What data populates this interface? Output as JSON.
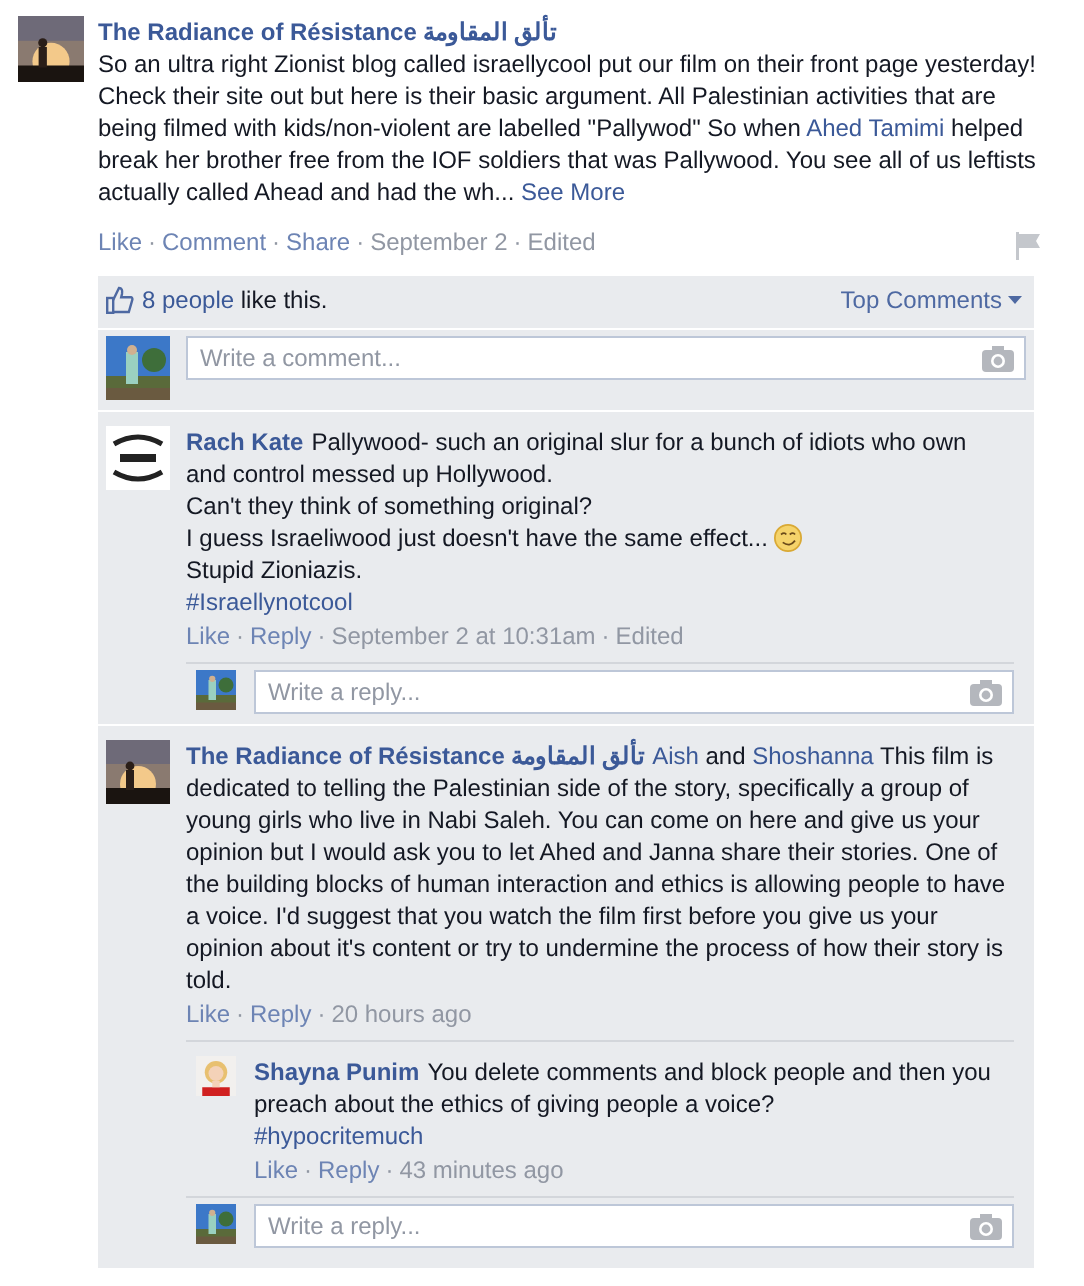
{
  "post": {
    "author": "The Radiance of Résistance تألق المقاومة",
    "body": [
      {
        "kind": "text",
        "text": "So an ultra right Zionist blog called israellycool put our film on their front page yesterday! Check their site out but here is their basic argument. All Palestinian activities that are being filmed with kids/non-violent are labelled \"Pallywod\" So when "
      },
      {
        "kind": "link",
        "text": "Ahed Tamimi"
      },
      {
        "kind": "text",
        "text": " helped break her brother free from the IOF soldiers that was Pallywood. You see all of us leftists actually called Ahead and had the wh... "
      },
      {
        "kind": "link",
        "text": "See More"
      }
    ],
    "actions": [
      {
        "kind": "link",
        "text": "Like"
      },
      {
        "kind": "sep",
        "text": "·"
      },
      {
        "kind": "link",
        "text": "Comment"
      },
      {
        "kind": "sep",
        "text": "·"
      },
      {
        "kind": "link",
        "text": "Share"
      },
      {
        "kind": "sep",
        "text": "·"
      },
      {
        "kind": "meta",
        "text": "September 2"
      },
      {
        "kind": "sep",
        "text": "·"
      },
      {
        "kind": "meta",
        "text": "Edited"
      }
    ]
  },
  "likes": {
    "count_link": "8 people",
    "text": " like this.",
    "sort": "Top Comments"
  },
  "comment_box": {
    "placeholder": "Write a comment..."
  },
  "comments": [
    {
      "author": "Rach Kate",
      "body": [
        {
          "kind": "text",
          "text": "Pallywood- such an original slur for a bunch of idiots who own and control messed up Hollywood.\nCan't they think of something original?\nI guess Israeliwood just doesn't have the same effect... "
        },
        {
          "kind": "emoji"
        },
        {
          "kind": "text",
          "text": "\nStupid Zioniazis.\n"
        },
        {
          "kind": "link",
          "text": "#Israellynotcool"
        }
      ],
      "actions": [
        {
          "kind": "link",
          "text": "Like"
        },
        {
          "kind": "sep",
          "text": "·"
        },
        {
          "kind": "link",
          "text": "Reply"
        },
        {
          "kind": "sep",
          "text": "·"
        },
        {
          "kind": "meta",
          "text": "September 2 at 10:31am"
        },
        {
          "kind": "sep",
          "text": "·"
        },
        {
          "kind": "meta",
          "text": "Edited"
        }
      ],
      "reply_box": {
        "placeholder": "Write a reply..."
      }
    },
    {
      "author": "The Radiance of Résistance تألق المقاومة",
      "body": [
        {
          "kind": "link",
          "text": "Aish"
        },
        {
          "kind": "text",
          "text": " and "
        },
        {
          "kind": "link",
          "text": "Shoshanna"
        },
        {
          "kind": "text",
          "text": " This film is dedicated to telling the Palestinian side of the story, specifically a group of young girls who live in Nabi Saleh. You can come on here and give us your opinion but I would ask you to let Ahed and Janna share their stories. One of the building blocks of human interaction and ethics is allowing people to have a voice. I'd suggest that you watch the film first before you give us your opinion about it's content or try to undermine the process of how their story is told."
        }
      ],
      "actions": [
        {
          "kind": "link",
          "text": "Like"
        },
        {
          "kind": "sep",
          "text": "·"
        },
        {
          "kind": "link",
          "text": "Reply"
        },
        {
          "kind": "sep",
          "text": "·"
        },
        {
          "kind": "meta",
          "text": "20 hours ago"
        }
      ],
      "replies": [
        {
          "author": "Shayna Punim",
          "body": [
            {
              "kind": "text",
              "text": "You delete comments and block people and then you preach about the ethics of giving people a voice?\n"
            },
            {
              "kind": "link",
              "text": "#hypocritemuch"
            }
          ],
          "actions": [
            {
              "kind": "link",
              "text": "Like"
            },
            {
              "kind": "sep",
              "text": "·"
            },
            {
              "kind": "link",
              "text": "Reply"
            },
            {
              "kind": "sep",
              "text": "·"
            },
            {
              "kind": "meta",
              "text": "43 minutes ago"
            }
          ]
        }
      ],
      "reply_box": {
        "placeholder": "Write a reply..."
      }
    }
  ]
}
